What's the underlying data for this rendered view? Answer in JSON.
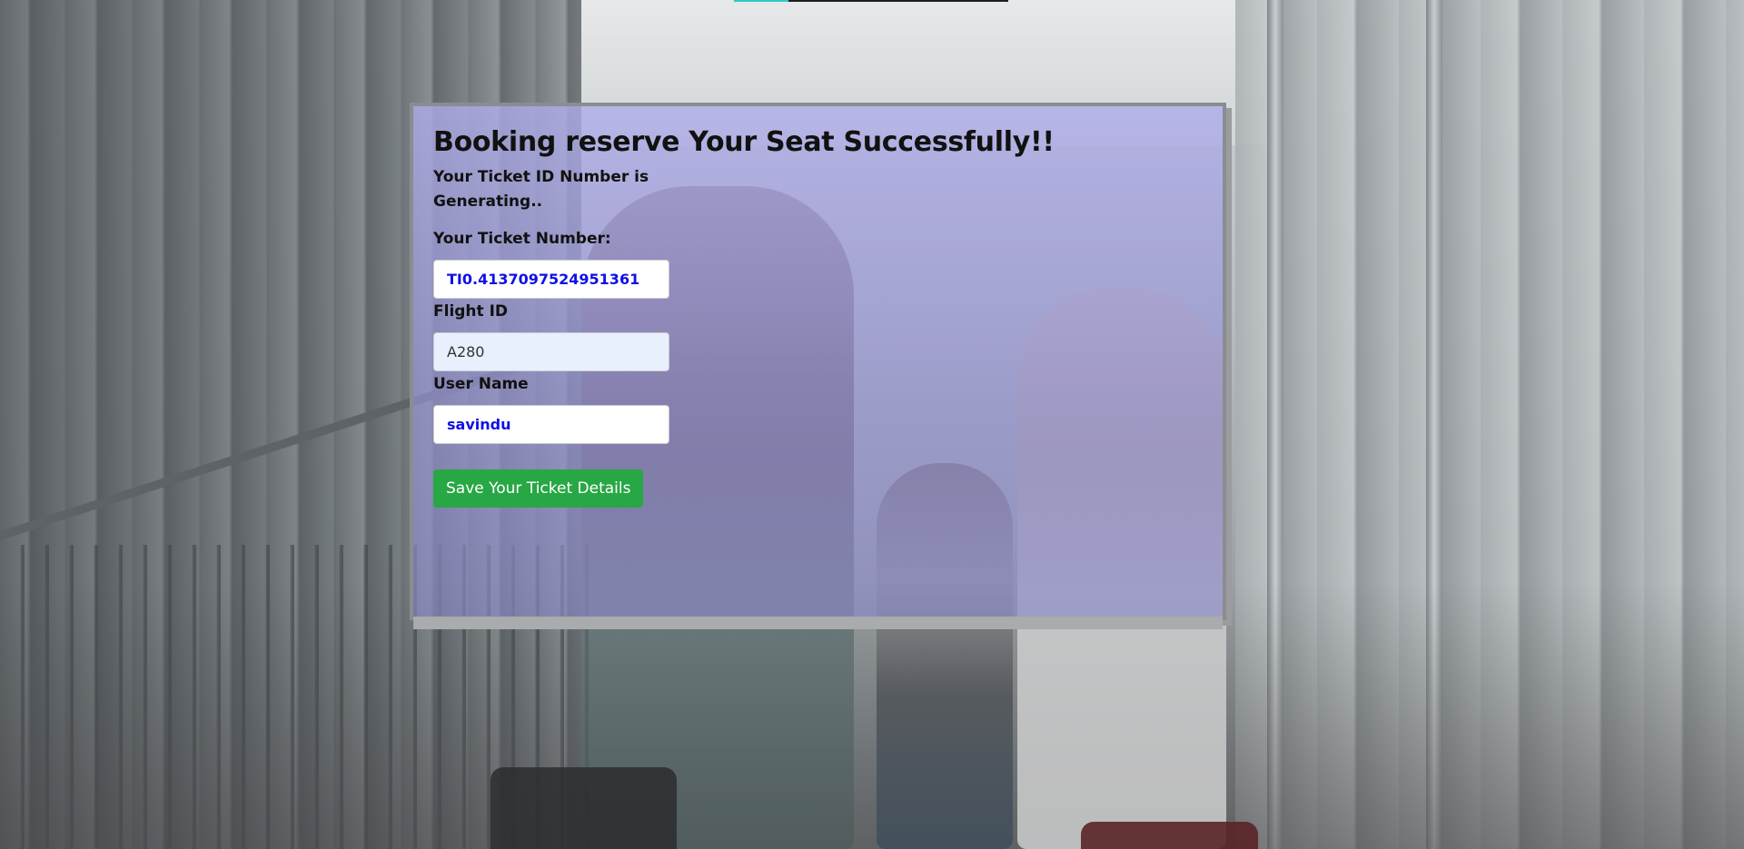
{
  "booking": {
    "headline": "Booking reserve Your Seat Successfully!!",
    "status_text": "Your Ticket ID Number is Generating..",
    "ticket_number_label": "Your Ticket Number:",
    "ticket_number_value": "TI0.4137097524951361",
    "flight_id_label": "Flight ID",
    "flight_id_value": "A280",
    "user_name_label": "User Name",
    "user_name_value": "savindu",
    "save_button_label": "Save Your Ticket Details"
  },
  "colors": {
    "card_tint": "#9b9ae0",
    "button": "#28a745",
    "value_text": "#1010e6",
    "autofill_bg": "#e8f0fe"
  }
}
